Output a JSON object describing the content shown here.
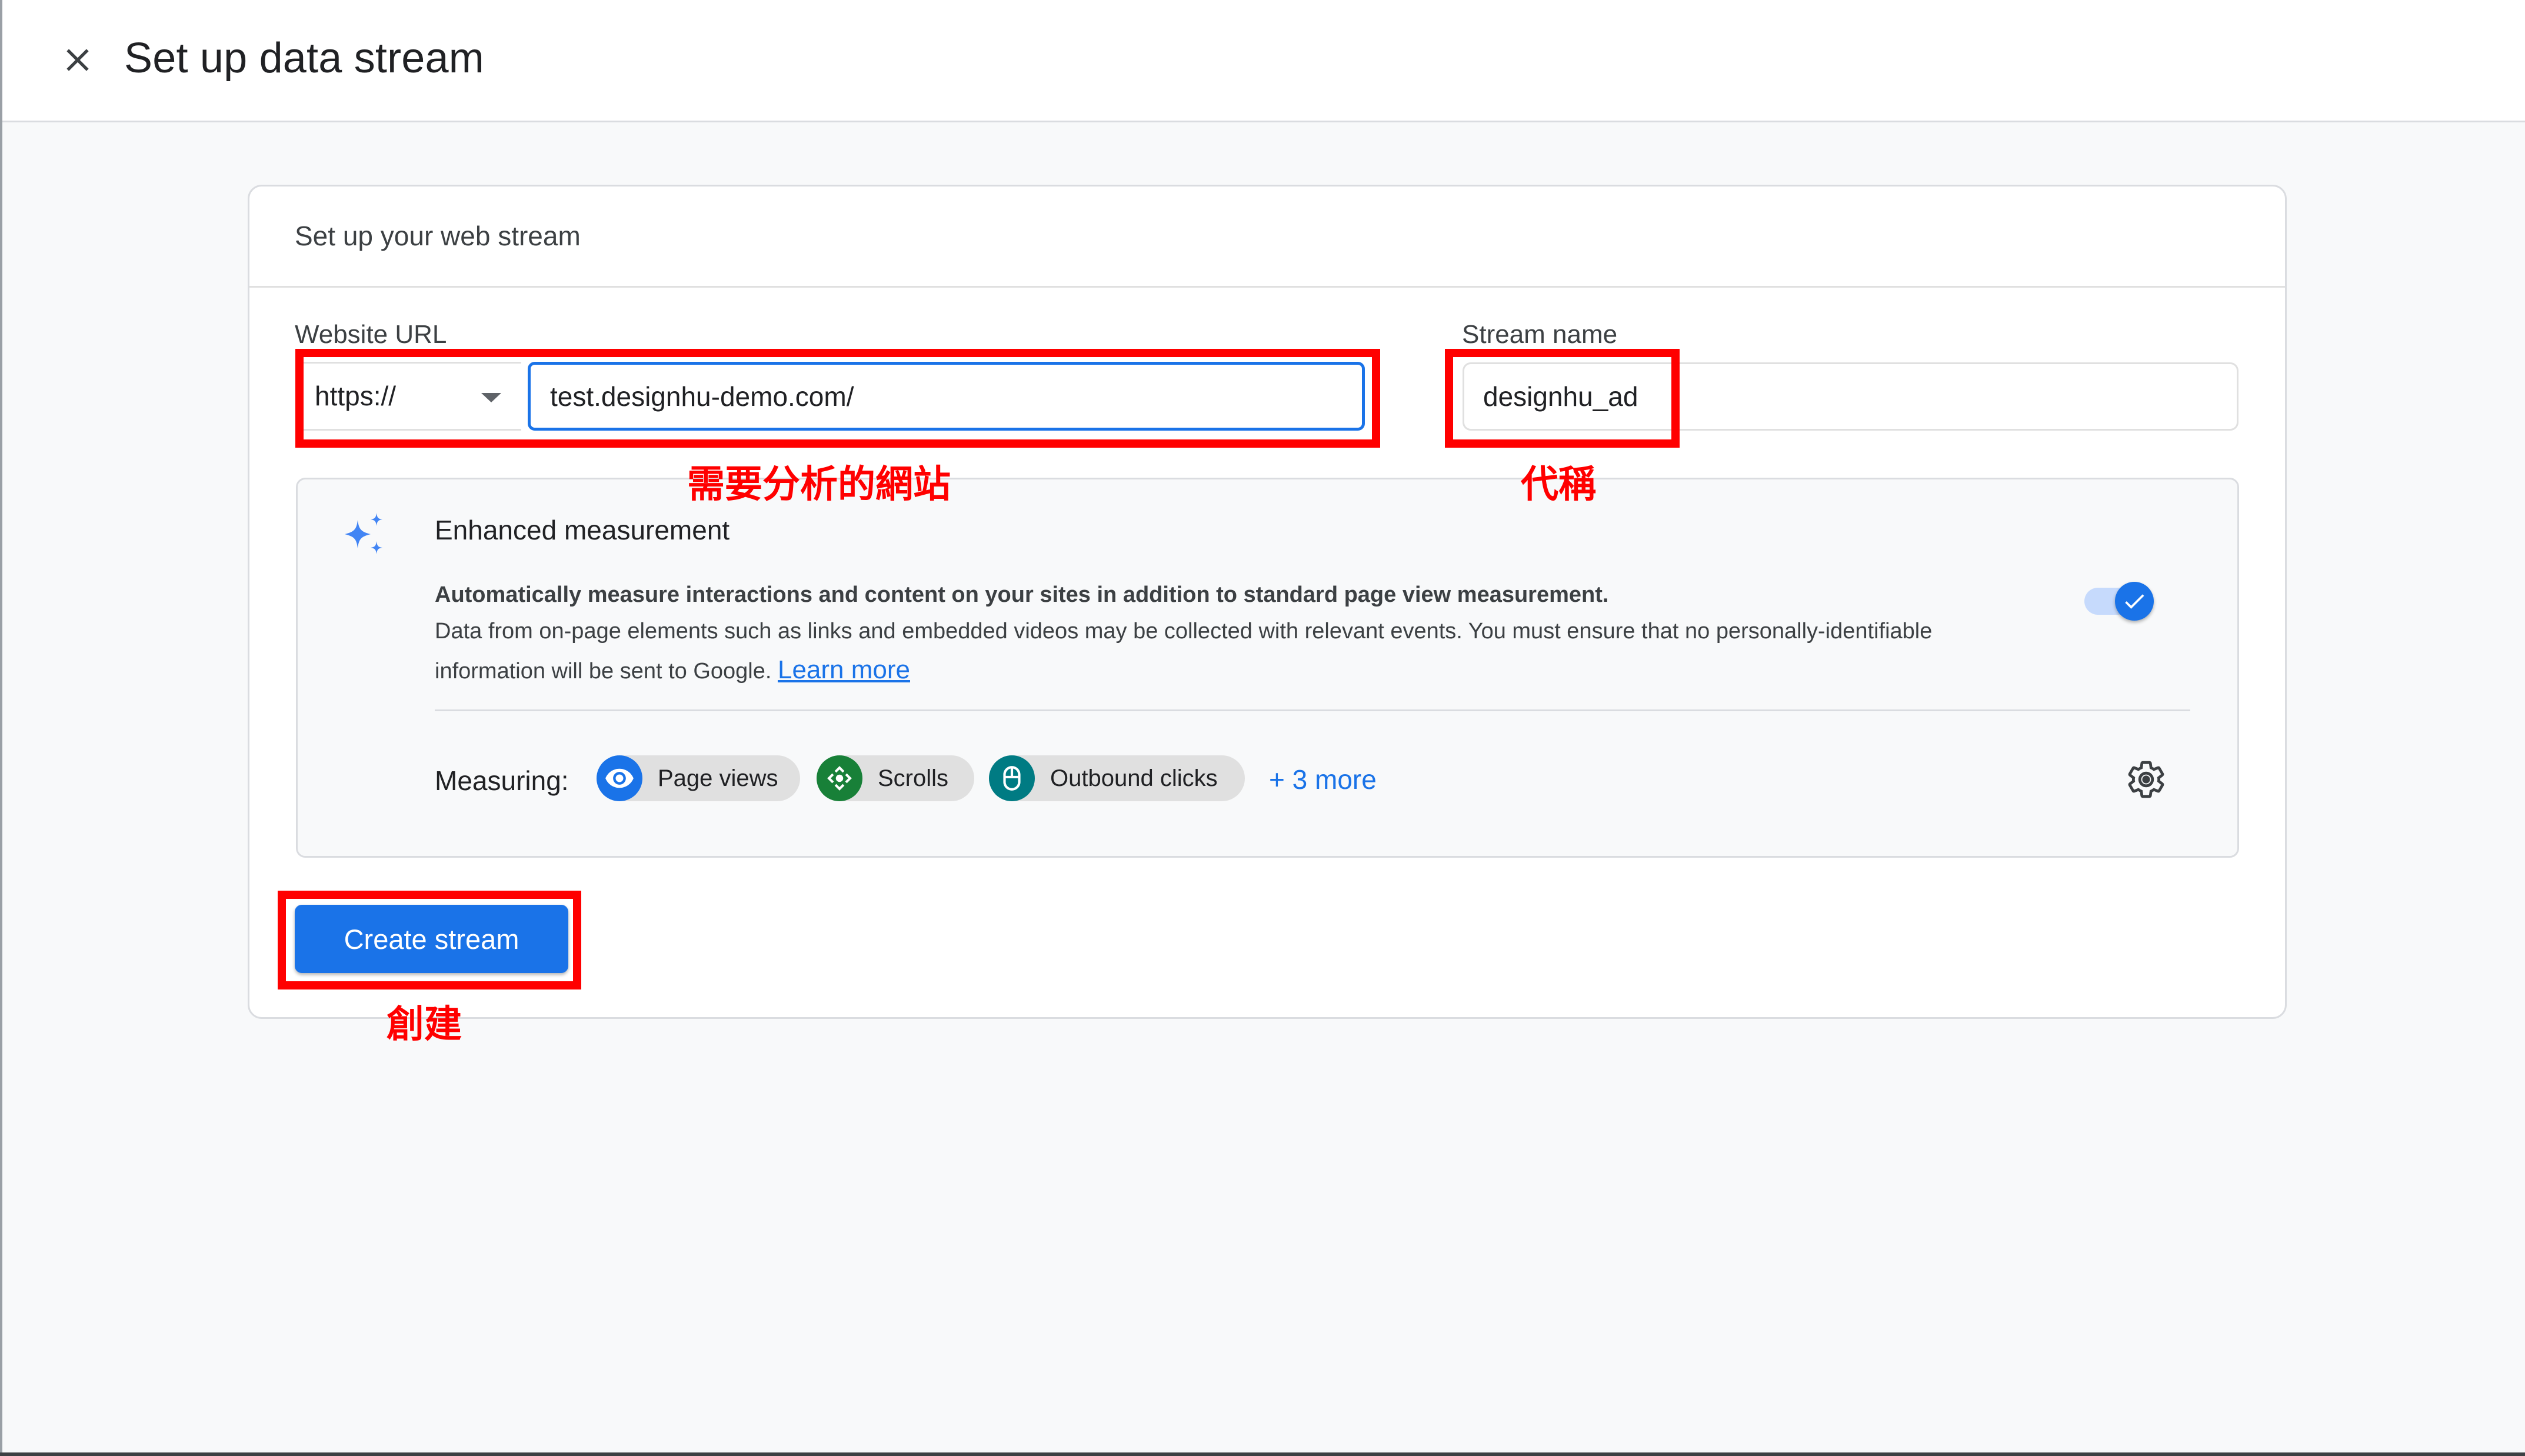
{
  "header": {
    "title": "Set up data stream",
    "close_icon": "close-icon"
  },
  "card": {
    "title": "Set up your web stream",
    "website_url": {
      "label": "Website URL",
      "protocol_selected": "https://",
      "url_value": "test.designhu-demo.com/"
    },
    "stream_name": {
      "label": "Stream name",
      "value": "designhu_ad"
    },
    "enhanced_measurement": {
      "icon": "sparkle-icon",
      "title": "Enhanced measurement",
      "description_bold": "Automatically measure interactions and content on your sites in addition to standard page view measurement.",
      "description_line1": "Data from on-page elements such as links and embedded videos may be collected with relevant events. You must ensure that no personally-identifiable",
      "description_line2": "information will be sent to Google.",
      "learn_more": "Learn more",
      "toggle_on": true,
      "measuring_label": "Measuring:",
      "chips": [
        {
          "label": "Page views",
          "icon": "eye-icon",
          "color": "#1a73e8"
        },
        {
          "label": "Scrolls",
          "icon": "scroll-icon",
          "color": "#188038"
        },
        {
          "label": "Outbound clicks",
          "icon": "mouse-icon",
          "color": "#007b83"
        }
      ],
      "more_link": "+ 3 more",
      "settings_icon": "gear-icon"
    },
    "create_button": "Create stream"
  },
  "annotations": {
    "url_note": "需要分析的網站",
    "stream_note": "代稱",
    "create_note": "創建",
    "color": "#ff0000"
  },
  "colors": {
    "primary": "#1a73e8",
    "background": "#f8f9fa",
    "border": "#dadce0"
  }
}
